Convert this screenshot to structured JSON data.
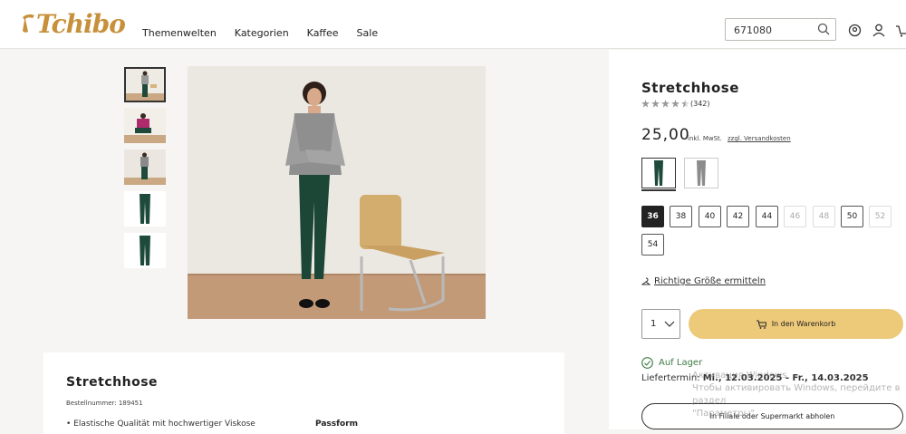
{
  "header": {
    "logo": "Tchibo",
    "nav": [
      "Themenwelten",
      "Kategorien",
      "Kaffee",
      "Sale"
    ],
    "search_value": "671080",
    "icons": [
      "search-icon",
      "location-icon",
      "user-icon",
      "cart-icon"
    ]
  },
  "product": {
    "title": "Stretchhose",
    "rating": 4.5,
    "review_count": "(342)",
    "price": "25,00",
    "vat_text": "inkl. MwSt.",
    "shipping_link": "zzgl. Versandkosten",
    "colors": [
      "dark-green",
      "grey"
    ],
    "sizes": [
      {
        "label": "36",
        "state": "selected"
      },
      {
        "label": "38",
        "state": "available"
      },
      {
        "label": "40",
        "state": "available"
      },
      {
        "label": "42",
        "state": "available"
      },
      {
        "label": "44",
        "state": "available"
      },
      {
        "label": "46",
        "state": "unavailable"
      },
      {
        "label": "48",
        "state": "unavailable"
      },
      {
        "label": "50",
        "state": "available"
      },
      {
        "label": "52",
        "state": "unavailable"
      },
      {
        "label": "54",
        "state": "available"
      }
    ],
    "size_help": "Richtige Größe ermitteln",
    "quantity": "1",
    "cart_button": "In den Warenkorb",
    "stock": "Auf Lager",
    "delivery_label": "Liefertermin:",
    "delivery_dates": "Mi., 12.03.2025 - Fr., 14.03.2025",
    "store_button": "In Filiale oder Supermarkt abholen"
  },
  "description": {
    "title": "Stretchhose",
    "sku": "Bestellnummer: 189451",
    "bullet": "Elastische Qualität mit hochwertiger Viskose",
    "section": "Passform"
  },
  "watermark": {
    "line1": "Активация Windows",
    "line2": "Чтобы активировать Windows, перейдите в раздел",
    "line3": "\"Параметры\"."
  },
  "colors": {
    "brand": "#c7903a",
    "cart_button": "#edc97a",
    "stock": "#3f7a45"
  }
}
